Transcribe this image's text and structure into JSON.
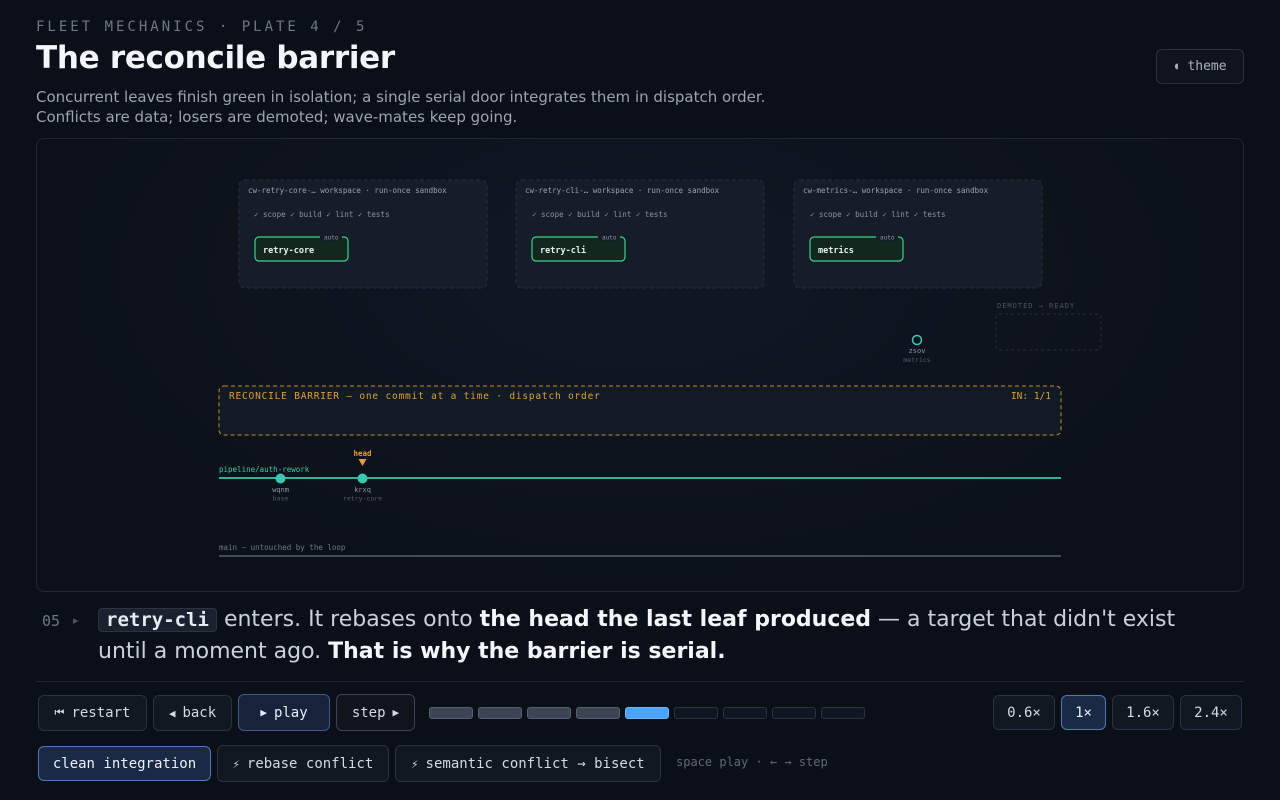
{
  "header": {
    "eyebrow": "FLEET MECHANICS · PLATE 4 / 5",
    "title": "The reconcile barrier",
    "subtitle": "Concurrent leaves finish green in isolation; a single serial door integrates them in dispatch order. Conflicts are data; losers are demoted; wave-mates keep going.",
    "theme_label": "theme",
    "theme_icon": "◖"
  },
  "diagram": {
    "workspaces": [
      {
        "header": "cw-retry-core-… workspace · run-once sandbox",
        "checks": "✓ scope ✓ build ✓ lint ✓ tests",
        "leaf": "retry-core",
        "badge": "auto"
      },
      {
        "header": "cw-retry-cli-… workspace · run-once sandbox",
        "checks": "✓ scope ✓ build ✓ lint ✓ tests",
        "leaf": "retry-cli",
        "badge": "auto"
      },
      {
        "header": "cw-metrics-… workspace · run-once sandbox",
        "checks": "✓ scope ✓ build ✓ lint ✓ tests",
        "leaf": "metrics",
        "badge": "auto"
      }
    ],
    "demoted_label": "DEMOTED → READY",
    "floating_commit": {
      "id": "zsov",
      "sub": "metrics"
    },
    "barrier": {
      "label": "RECONCILE BARRIER — one commit at a time · dispatch order",
      "counter": "IN: 1/1"
    },
    "head_label": "head",
    "branch_label": "pipeline/auth-rework",
    "commits": [
      {
        "id": "wqnm",
        "sub": "base"
      },
      {
        "id": "krxq",
        "sub": "retry-core"
      }
    ],
    "main_label": "main — untouched by the loop"
  },
  "narration": {
    "step": "05",
    "step_marker": "▸",
    "code": "retry-cli",
    "t1": " enters. It rebases onto ",
    "b1": "the head the last leaf produced",
    "t2": " — a target that didn't exist until a moment ago. ",
    "b2": "That is why the barrier is serial."
  },
  "controls": {
    "restart": {
      "icon": "⏮",
      "label": "restart"
    },
    "back": {
      "icon": "◀",
      "label": "back"
    },
    "play": {
      "icon": "▶",
      "label": "play"
    },
    "step": {
      "icon": "▶",
      "label": "step"
    },
    "progress": {
      "total": 9,
      "current": 5
    },
    "speeds": [
      "0.6×",
      "1×",
      "1.6×",
      "2.4×"
    ],
    "active_speed": "1×"
  },
  "scenarios": {
    "clean": "clean integration",
    "rebase": {
      "icon": "⚡",
      "label": "rebase conflict"
    },
    "semantic": {
      "icon": "⚡",
      "label": "semantic conflict → bisect"
    },
    "hint": "space play · ← → step"
  },
  "colors": {
    "green": "#3fd08a",
    "teal": "#3bc7b0",
    "amber": "#e0a030",
    "accent": "#4aa3ff"
  }
}
